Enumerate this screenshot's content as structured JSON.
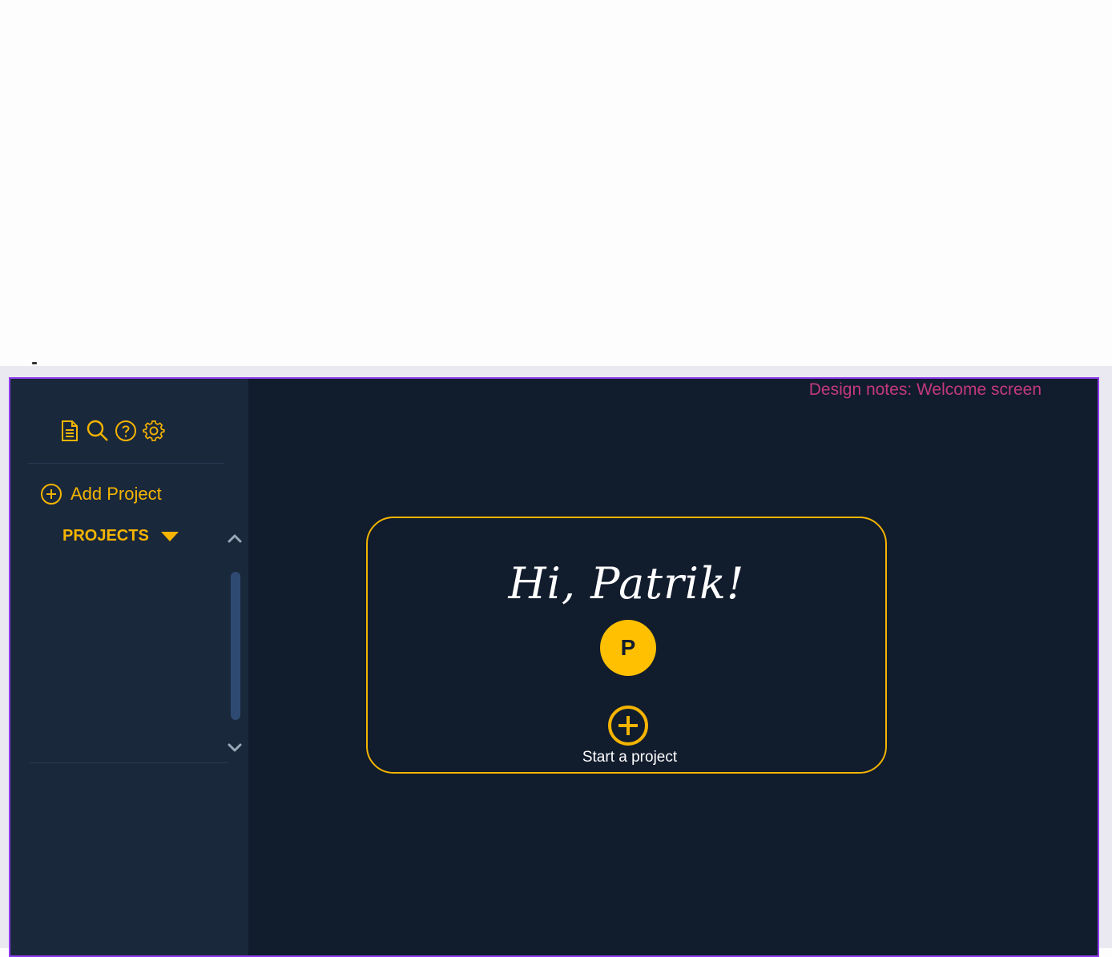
{
  "sidebar": {
    "toolbar": [
      {
        "icon": "document-icon",
        "label": ""
      },
      {
        "icon": "search-icon",
        "label": ""
      },
      {
        "icon": "help-icon",
        "label": ""
      },
      {
        "icon": "gear-icon",
        "label": ""
      }
    ],
    "add_project_label": "Add Project",
    "projects_label": "PROJECTS"
  },
  "main": {
    "design_notes": "Design notes: Welcome screen",
    "greeting": "Hi, Patrik!",
    "avatar_initial": "P",
    "start_project_label": "Start a project"
  },
  "colors": {
    "accent": "#f4b400",
    "avatar": "#fec001",
    "main_background": "#111c2d",
    "sidebar_background": "#1a283c",
    "frame_border": "#8f3cf0",
    "design_notes": "#c2397f"
  }
}
